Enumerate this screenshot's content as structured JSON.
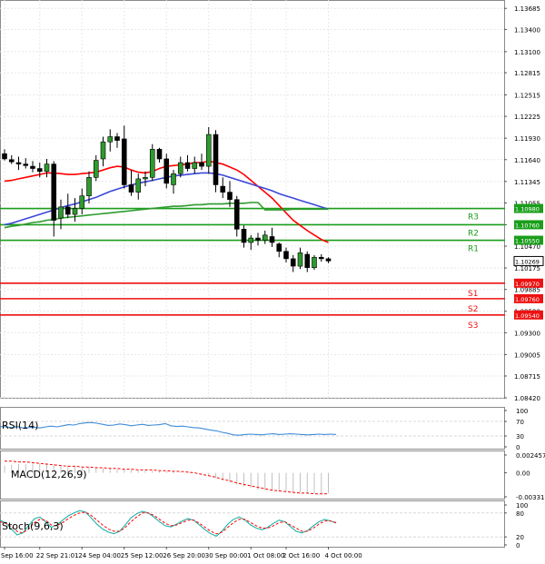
{
  "chart_data": {
    "type": "candlestick",
    "instrument": "EURUSD",
    "main": {
      "ylim": [
        1.0842,
        1.137
      ],
      "y_ticks": [
        "1.13685",
        "1.13400",
        "1.13100",
        "1.12815",
        "1.12515",
        "1.12225",
        "1.11930",
        "1.11640",
        "1.11345",
        "1.11055",
        "1.10760",
        "1.10470",
        "1.10175",
        "1.09885",
        "1.09590",
        "1.09300",
        "1.09005",
        "1.08715",
        "1.08420"
      ],
      "grid": true,
      "candles": [
        [
          1.1172,
          1.1178,
          1.1163,
          1.1165
        ],
        [
          1.1164,
          1.117,
          1.1158,
          1.1161
        ],
        [
          1.116,
          1.1168,
          1.115,
          1.1158
        ],
        [
          1.1158,
          1.1166,
          1.1152,
          1.1156
        ],
        [
          1.1155,
          1.1162,
          1.1147,
          1.1152
        ],
        [
          1.1152,
          1.116,
          1.114,
          1.1148
        ],
        [
          1.1148,
          1.1165,
          1.114,
          1.1158
        ],
        [
          1.1158,
          1.1162,
          1.106,
          1.1082
        ],
        [
          1.1085,
          1.111,
          1.107,
          1.11
        ],
        [
          1.11,
          1.1118,
          1.1085,
          1.109
        ],
        [
          1.109,
          1.1112,
          1.108,
          1.1098
        ],
        [
          1.1098,
          1.1125,
          1.109,
          1.1115
        ],
        [
          1.1115,
          1.1148,
          1.1105,
          1.114
        ],
        [
          1.114,
          1.117,
          1.1135,
          1.1163
        ],
        [
          1.1165,
          1.1195,
          1.1155,
          1.1188
        ],
        [
          1.1188,
          1.1205,
          1.1175,
          1.1195
        ],
        [
          1.1195,
          1.12,
          1.118,
          1.119
        ],
        [
          1.1192,
          1.121,
          1.1125,
          1.113
        ],
        [
          1.113,
          1.115,
          1.1115,
          1.112
        ],
        [
          1.112,
          1.1145,
          1.111,
          1.1138
        ],
        [
          1.1138,
          1.1148,
          1.1128,
          1.114
        ],
        [
          1.114,
          1.1185,
          1.1135,
          1.1178
        ],
        [
          1.1178,
          1.118,
          1.116,
          1.1165
        ],
        [
          1.1165,
          1.1172,
          1.1125,
          1.1132
        ],
        [
          1.113,
          1.115,
          1.1118,
          1.1145
        ],
        [
          1.1145,
          1.1168,
          1.114,
          1.116
        ],
        [
          1.116,
          1.117,
          1.1148,
          1.1152
        ],
        [
          1.1152,
          1.1168,
          1.1145,
          1.116
        ],
        [
          1.116,
          1.1172,
          1.115,
          1.1155
        ],
        [
          1.1155,
          1.1208,
          1.1145,
          1.1198
        ],
        [
          1.1198,
          1.1204,
          1.112,
          1.113
        ],
        [
          1.1128,
          1.114,
          1.1112,
          1.112
        ],
        [
          1.112,
          1.1135,
          1.11,
          1.111
        ],
        [
          1.111,
          1.1115,
          1.106,
          1.107
        ],
        [
          1.107,
          1.1075,
          1.1045,
          1.1052
        ],
        [
          1.1052,
          1.1062,
          1.1042,
          1.1058
        ],
        [
          1.1058,
          1.1065,
          1.1048,
          1.1055
        ],
        [
          1.1055,
          1.1068,
          1.105,
          1.1062
        ],
        [
          1.106,
          1.1072,
          1.1046,
          1.1052
        ],
        [
          1.105,
          1.1052,
          1.1032,
          1.104
        ],
        [
          1.104,
          1.1045,
          1.1025,
          1.103
        ],
        [
          1.103,
          1.1035,
          1.1012,
          1.102
        ],
        [
          1.102,
          1.1045,
          1.1016,
          1.1038
        ],
        [
          1.1036,
          1.104,
          1.1012,
          1.1018
        ],
        [
          1.1018,
          1.1035,
          1.1015,
          1.1032
        ],
        [
          1.1032,
          1.1036,
          1.1026,
          1.103
        ],
        [
          1.103,
          1.1032,
          1.1024,
          1.1027
        ]
      ],
      "series": [
        {
          "color": "#ff0000",
          "values": [
            1.1135,
            1.1136,
            1.1138,
            1.114,
            1.1142,
            1.1144,
            1.1146,
            1.1146,
            1.1145,
            1.1144,
            1.1144,
            1.1145,
            1.1146,
            1.1147,
            1.115,
            1.1153,
            1.1155,
            1.1154,
            1.115,
            1.1147,
            1.1146,
            1.1148,
            1.1152,
            1.1155,
            1.1156,
            1.1157,
            1.1158,
            1.116,
            1.116,
            1.1162,
            1.116,
            1.1158,
            1.1154,
            1.115,
            1.1144,
            1.1136,
            1.1128,
            1.112,
            1.1112,
            1.1102,
            1.1092,
            1.1082,
            1.1075,
            1.1068,
            1.1062,
            1.1056,
            1.1052
          ]
        },
        {
          "color": "#3b48d8",
          "values": [
            1.1076,
            1.1078,
            1.1081,
            1.1084,
            1.1087,
            1.109,
            1.1093,
            1.1096,
            1.1099,
            1.1102,
            1.1104,
            1.1107,
            1.111,
            1.1113,
            1.1117,
            1.1121,
            1.1124,
            1.1127,
            1.113,
            1.1132,
            1.1134,
            1.1136,
            1.1138,
            1.114,
            1.1142,
            1.1143,
            1.1144,
            1.1145,
            1.1146,
            1.1146,
            1.1145,
            1.1143,
            1.114,
            1.1137,
            1.1134,
            1.1131,
            1.1128,
            1.1125,
            1.1122,
            1.1118,
            1.1115,
            1.1112,
            1.1109,
            1.1106,
            1.1103,
            1.11,
            1.1097
          ]
        },
        {
          "color": "#2e9b2e",
          "values": [
            1.1072,
            1.1074,
            1.1075,
            1.1077,
            1.1079,
            1.108,
            1.1082,
            1.1083,
            1.1085,
            1.1086,
            1.1087,
            1.1088,
            1.1089,
            1.109,
            1.1091,
            1.1092,
            1.1093,
            1.1094,
            1.1095,
            1.1096,
            1.1097,
            1.1098,
            1.1099,
            1.11,
            1.1101,
            1.1101,
            1.1102,
            1.1103,
            1.1103,
            1.1104,
            1.1104,
            1.1104,
            1.1105,
            1.1105,
            1.1105,
            1.1106,
            1.1106,
            1.1096,
            1.1096,
            1.1096,
            1.1096,
            1.1097,
            1.1097,
            1.1097,
            1.1097,
            1.1097,
            1.1097
          ]
        }
      ],
      "levels": [
        {
          "name": "R3",
          "value": 1.1098,
          "tag": "1.10980",
          "color": "#1a9e1a"
        },
        {
          "name": "R2",
          "value": 1.1076,
          "tag": "1.10760",
          "color": "#1a9e1a"
        },
        {
          "name": "R1",
          "value": 1.1055,
          "tag": "1.10550",
          "color": "#1a9e1a"
        },
        {
          "name": "S1",
          "value": 1.0997,
          "tag": "1.09970",
          "color": "#ee1111"
        },
        {
          "name": "S2",
          "value": 1.0976,
          "tag": "1.09760",
          "color": "#ee1111"
        },
        {
          "name": "S3",
          "value": 1.0954,
          "tag": "1.09540",
          "color": "#ee1111"
        }
      ],
      "current_price": "1.10269"
    },
    "rsi": {
      "label": "RSI(14)",
      "ylim": [
        0,
        100
      ],
      "y_ticks": [
        "100",
        "70",
        "30",
        "0"
      ],
      "color": "#3d8bd8",
      "values": [
        56,
        55,
        53,
        56,
        52,
        53,
        54,
        52,
        55,
        57,
        55,
        58,
        61,
        60,
        64,
        66,
        67,
        65,
        62,
        59,
        60,
        63,
        61,
        58,
        60,
        62,
        59,
        60,
        61,
        64,
        58,
        56,
        57,
        55,
        53,
        52,
        49,
        46,
        44,
        40,
        37,
        33,
        32,
        34,
        35,
        34,
        33,
        35,
        36,
        34,
        35,
        36,
        35,
        34,
        33,
        34,
        35,
        34,
        35,
        34
      ]
    },
    "macd": {
      "label": "MACD(12,26,9)",
      "y_ticks": [
        "0.002457",
        "0.00",
        "-0.00331"
      ],
      "ylim": [
        -0.00331,
        0.002457
      ],
      "hist_color": "#c0c0c0",
      "signal_color": "#ff0000",
      "histogram": [
        0.001,
        0.0011,
        0.0012,
        0.0012,
        0.0013,
        0.0013,
        0.0013,
        0.0012,
        0.0011,
        0.001,
        0.0009,
        0.0008,
        0.0008,
        0.0007,
        0.0006,
        0.0006,
        0.0005,
        0.0005,
        0.0004,
        0.0003,
        0.0003,
        0.0003,
        0.0002,
        0.0002,
        0.0002,
        0.0001,
        0.0001,
        0.0,
        -0.0002,
        -0.0004,
        -0.0007,
        -0.001,
        -0.0013,
        -0.0016,
        -0.0019,
        -0.0021,
        -0.0023,
        -0.0024,
        -0.0025,
        -0.0026,
        -0.0026,
        -0.0027,
        -0.0027,
        -0.0028,
        -0.0028,
        -0.0028,
        -0.0028
      ],
      "signal": [
        0.0016,
        0.0016,
        0.0015,
        0.0015,
        0.0014,
        0.0013,
        0.0012,
        0.0011,
        0.001,
        0.0009,
        0.0009,
        0.0008,
        0.0008,
        0.0007,
        0.0007,
        0.0006,
        0.0006,
        0.0005,
        0.0005,
        0.0004,
        0.0004,
        0.0004,
        0.0003,
        0.0003,
        0.0002,
        0.0002,
        0.0001,
        0.0,
        -0.0002,
        -0.0004,
        -0.0006,
        -0.0009,
        -0.0011,
        -0.0014,
        -0.0016,
        -0.0018,
        -0.002,
        -0.0022,
        -0.0024,
        -0.0025,
        -0.0026,
        -0.0027,
        -0.0028,
        -0.0028,
        -0.0029,
        -0.0029,
        -0.0029
      ]
    },
    "stoch": {
      "label": "Stoch(9,6,3)",
      "y_ticks": [
        "100",
        "80",
        "20",
        "0"
      ],
      "ylim": [
        0,
        100
      ],
      "k_color": "#20b2aa",
      "d_color": "#ff0000",
      "k": [
        62,
        55,
        40,
        25,
        30,
        48,
        65,
        70,
        58,
        44,
        50,
        62,
        73,
        80,
        86,
        82,
        68,
        52,
        40,
        32,
        28,
        34,
        50,
        68,
        78,
        84,
        80,
        70,
        58,
        48,
        45,
        52,
        60,
        66,
        62,
        50,
        38,
        28,
        22,
        35,
        52,
        64,
        70,
        62,
        50,
        42,
        38,
        44,
        54,
        62,
        58,
        46,
        34,
        30,
        36,
        48,
        58,
        64,
        60,
        55
      ],
      "d": [
        58,
        54,
        46,
        34,
        30,
        40,
        55,
        64,
        62,
        50,
        48,
        56,
        66,
        74,
        80,
        82,
        74,
        62,
        50,
        40,
        34,
        34,
        44,
        58,
        70,
        80,
        80,
        74,
        64,
        54,
        48,
        50,
        56,
        62,
        62,
        54,
        44,
        34,
        28,
        32,
        44,
        56,
        64,
        64,
        56,
        48,
        42,
        42,
        48,
        56,
        58,
        50,
        42,
        34,
        34,
        42,
        52,
        60,
        60,
        56
      ]
    },
    "x_ticks": [
      {
        "label": "Sep 16:00",
        "x": 0
      },
      {
        "label": "22 Sep 21:01",
        "x": 5
      },
      {
        "label": "24 Sep 04:00",
        "x": 11
      },
      {
        "label": "25 Sep 12:00",
        "x": 17
      },
      {
        "label": "26 Sep 20:00",
        "x": 23
      },
      {
        "label": "30 Sep 00:00",
        "x": 29
      },
      {
        "label": "1 Oct 08:00",
        "x": 35
      },
      {
        "label": "2 Oct 16:00",
        "x": 40
      },
      {
        "label": "4 Oct 00:00",
        "x": 46
      }
    ]
  }
}
